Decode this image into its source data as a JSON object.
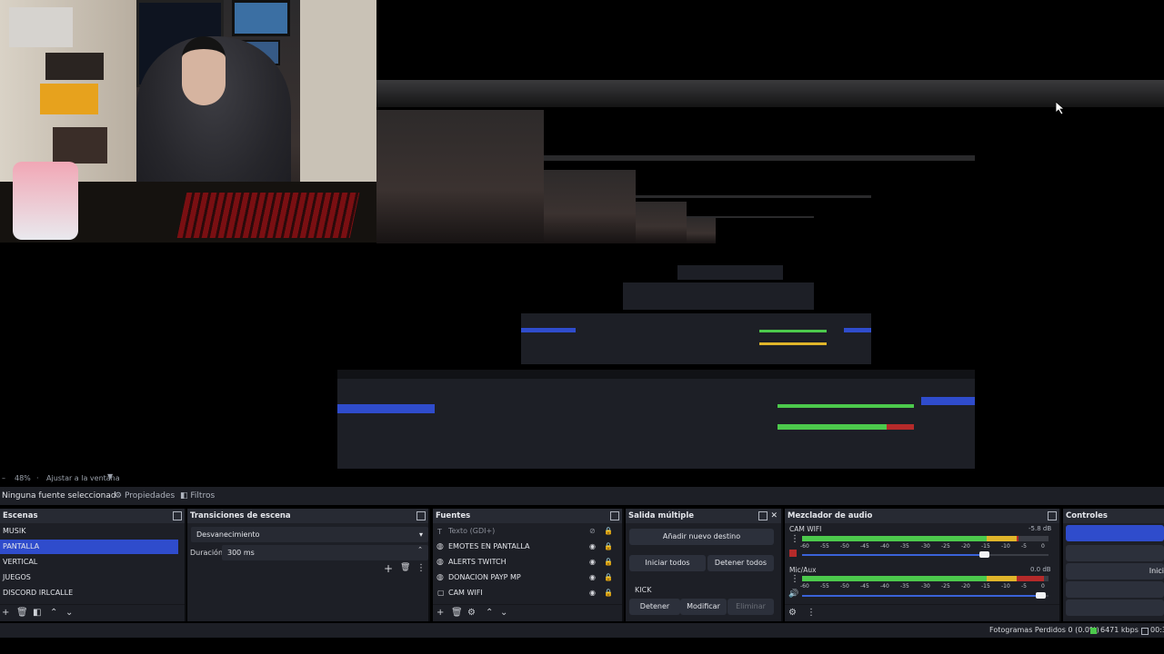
{
  "preview": {
    "zoom_label": "48%",
    "fit_label": "Ajustar a la ventana"
  },
  "propbar": {
    "no_source": "Ninguna fuente seleccionad",
    "properties": "Propiedades",
    "filters": "Filtros"
  },
  "scenes": {
    "title": "Escenas",
    "items": [
      "MUSIK",
      "PANTALLA",
      "VERTICAL",
      "JUEGOS",
      "DISCORD IRLCALLE"
    ],
    "selected": "PANTALLA"
  },
  "transitions": {
    "title": "Transiciones de escena",
    "transition": "Desvanecimiento",
    "duration_label": "Duración",
    "duration_value": "300 ms"
  },
  "sources": {
    "title": "Fuentes",
    "items": [
      "Texto (GDI+)",
      "EMOTES EN PANTALLA",
      "ALERTS TWITCH",
      "DONACION PAYP MP",
      "CAM WIFI"
    ]
  },
  "multiout": {
    "title": "Salida múltiple",
    "add_destination": "Añadir nuevo destino",
    "start_all": "Iniciar todos",
    "stop_all": "Detener todos",
    "target_name": "KICK",
    "stop": "Detener",
    "modify": "Modificar",
    "remove": "Eliminar"
  },
  "mixer": {
    "title": "Mezclador de audio",
    "channels": [
      {
        "name": "CAM WIFI",
        "db": "-5.8 dB",
        "level": 0.88,
        "volume": 0.74
      },
      {
        "name": "Mic/Aux",
        "db": "0.0 dB",
        "level": 0.98,
        "volume": 0.97
      }
    ],
    "scale": [
      "-60",
      "-55",
      "-50",
      "-45",
      "-40",
      "-35",
      "-30",
      "-25",
      "-20",
      "-15",
      "-10",
      "-5",
      "0"
    ]
  },
  "controls": {
    "title": "Controles",
    "start_label": "Inici"
  },
  "status": {
    "dropped_frames": "Fotogramas Perdidos 0 (0.0%)",
    "bitrate": "6471 kbps",
    "time": "00:3"
  },
  "colors": {
    "accent": "#2f4ccc",
    "meter_green": "#4cc94c",
    "meter_yellow": "#e0b52a",
    "meter_red": "#b52a2a",
    "volume_blue": "#3a62d8"
  }
}
